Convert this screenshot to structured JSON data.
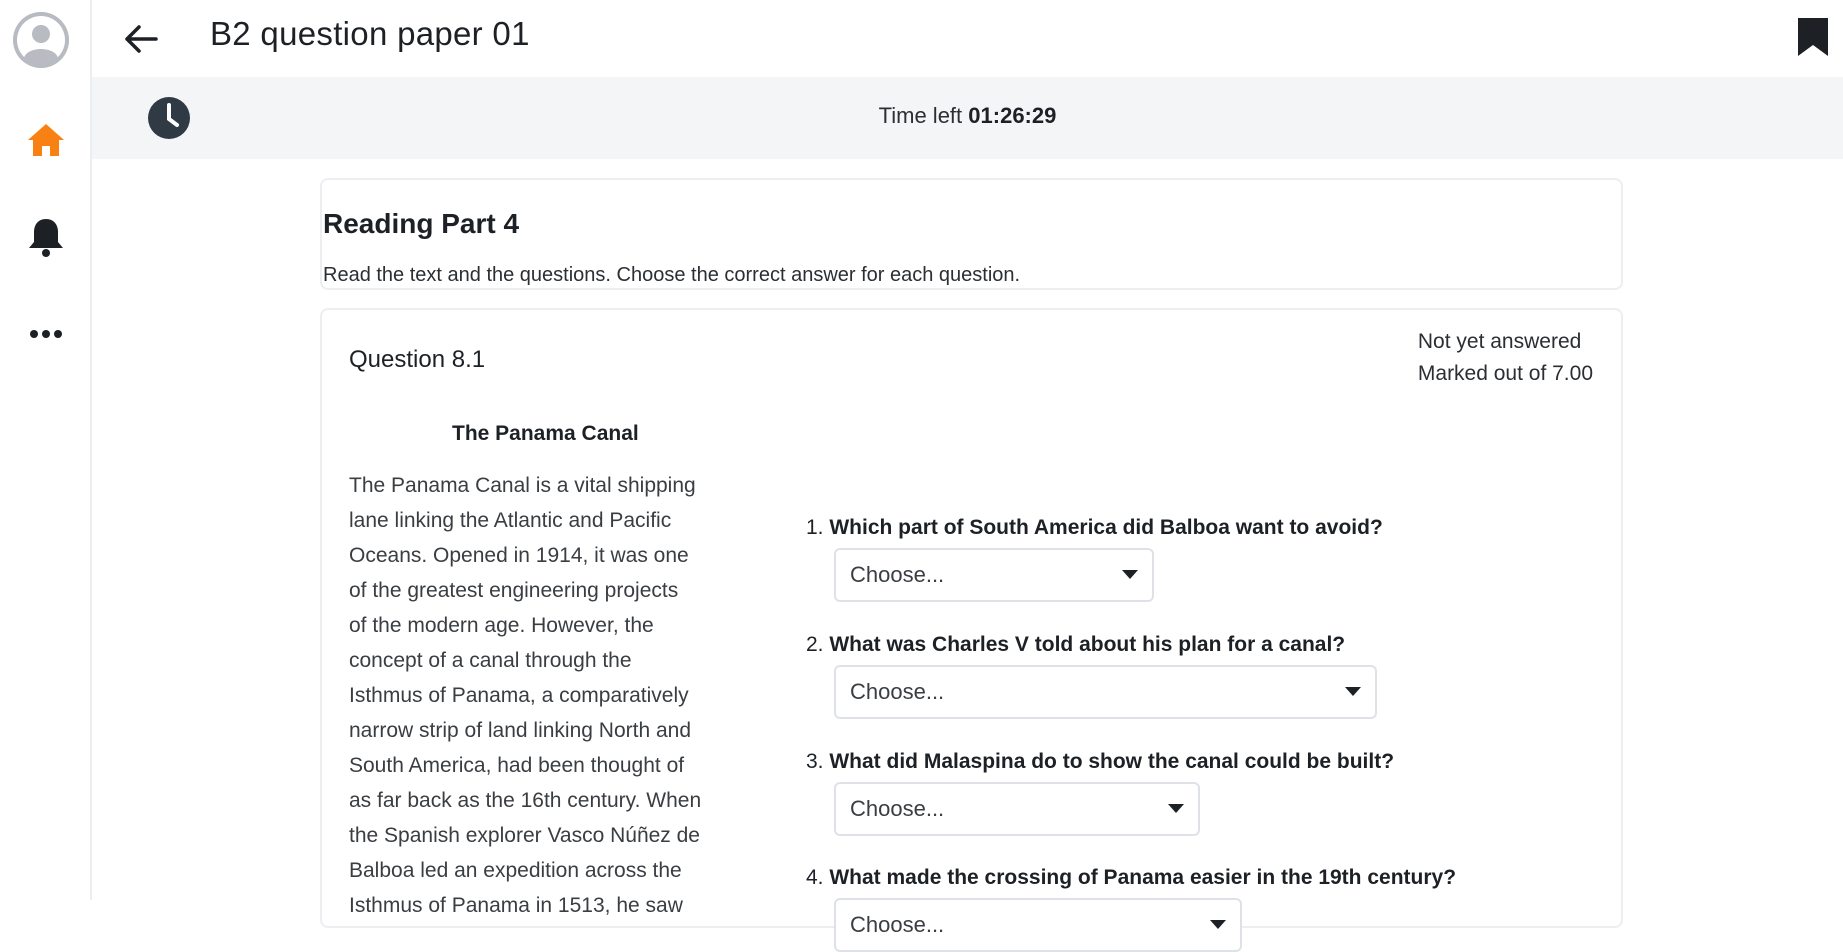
{
  "header": {
    "title": "B2 question paper 01"
  },
  "timer": {
    "label": "Time left",
    "value": "01:26:29"
  },
  "sidebar": {
    "items": [
      {
        "icon": "home-icon",
        "color": "#f98012"
      },
      {
        "icon": "bell-icon"
      },
      {
        "icon": "more-icon"
      }
    ]
  },
  "intro": {
    "title": "Reading Part 4",
    "description": "Read the text and the questions. Choose the correct answer for each question."
  },
  "question": {
    "label": "Question 8.1",
    "status": "Not yet answered",
    "marks": "Marked out of 7.00",
    "passage_title": "The Panama Canal",
    "passage_lines": [
      "The Panama Canal is a vital shipping",
      "lane linking the Atlantic and Pacific",
      "Oceans. Opened in 1914, it was one",
      "of the greatest engineering projects",
      "of the modern age. However, the",
      "concept of a canal through the",
      "Isthmus of Panama, a comparatively",
      "narrow strip of land linking North and",
      "South America, had been thought of",
      "as far back as the 16th century. When",
      "the Spanish explorer Vasco Núñez de",
      "Balboa led an expedition across the",
      "Isthmus of Panama in 1513, he saw"
    ],
    "subquestions": [
      {
        "number": "1.",
        "text": "Which part of South America did Balboa want to avoid?",
        "selected": "Choose..."
      },
      {
        "number": "2.",
        "text": "What was Charles V told about his plan for a canal?",
        "selected": "Choose..."
      },
      {
        "number": "3.",
        "text": "What did Malaspina do to show the canal could be built?",
        "selected": "Choose..."
      },
      {
        "number": "4.",
        "text": "What made the crossing of Panama easier in the 19th century?",
        "selected": "Choose..."
      }
    ]
  },
  "colors": {
    "accent": "#f98012",
    "timerbar_bg": "#f4f5f7"
  }
}
